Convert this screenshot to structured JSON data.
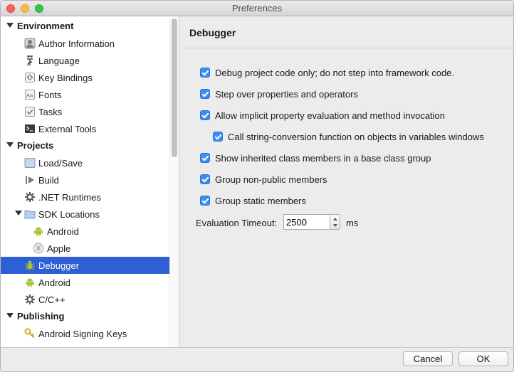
{
  "window": {
    "title": "Preferences"
  },
  "sidebar": {
    "categories": [
      {
        "label": "Environment",
        "items": [
          "Author Information",
          "Language",
          "Key Bindings",
          "Fonts",
          "Tasks",
          "External Tools"
        ]
      },
      {
        "label": "Projects",
        "items": [
          "Load/Save",
          "Build",
          ".NET Runtimes",
          "SDK Locations",
          "Android",
          "Apple",
          "Debugger",
          "Android",
          "C/C++"
        ]
      },
      {
        "label": "Publishing",
        "items": [
          "Android Signing Keys"
        ]
      }
    ],
    "selected": "Debugger",
    "selection_color": "#2f5fd4"
  },
  "content": {
    "title": "Debugger",
    "options": [
      {
        "label": "Debug project code only; do not step into framework code.",
        "checked": true
      },
      {
        "label": "Step over properties and operators",
        "checked": true
      },
      {
        "label": "Allow implicit property evaluation and method invocation",
        "checked": true
      },
      {
        "label": "Call string-conversion function on objects in variables windows",
        "checked": true
      },
      {
        "label": "Show inherited class members in a base class group",
        "checked": true
      },
      {
        "label": "Group non-public members",
        "checked": true
      },
      {
        "label": "Group static members",
        "checked": true
      }
    ],
    "timeout": {
      "label": "Evaluation Timeout:",
      "value": "2500",
      "unit": "ms"
    },
    "checkbox_color": "#3b8cf5"
  },
  "footer": {
    "cancel_label": "Cancel",
    "ok_label": "OK"
  }
}
